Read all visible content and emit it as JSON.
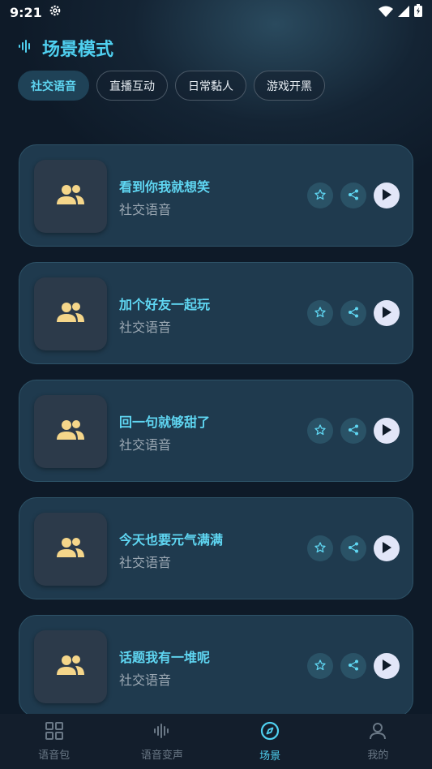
{
  "status_bar": {
    "time": "9:21"
  },
  "header": {
    "title": "场景模式",
    "icon": "sound-wave-icon"
  },
  "tabs": [
    {
      "label": "社交语音",
      "active": true
    },
    {
      "label": "直播互动",
      "active": false
    },
    {
      "label": "日常黏人",
      "active": false
    },
    {
      "label": "游戏开黑",
      "active": false
    }
  ],
  "cards": [
    {
      "title": "看到你我就想笑",
      "subtitle": "社交语音",
      "icon": "people-icon"
    },
    {
      "title": "加个好友一起玩",
      "subtitle": "社交语音",
      "icon": "people-icon"
    },
    {
      "title": "回一句就够甜了",
      "subtitle": "社交语音",
      "icon": "people-icon"
    },
    {
      "title": "今天也要元气满满",
      "subtitle": "社交语音",
      "icon": "people-icon"
    },
    {
      "title": "话题我有一堆呢",
      "subtitle": "社交语音",
      "icon": "people-icon"
    }
  ],
  "bottom_nav": [
    {
      "label": "语音包",
      "icon": "grid-icon",
      "active": false
    },
    {
      "label": "语音变声",
      "icon": "sound-wave-icon",
      "active": false
    },
    {
      "label": "场景",
      "icon": "compass-icon",
      "active": true
    },
    {
      "label": "我的",
      "icon": "person-icon",
      "active": false
    }
  ],
  "colors": {
    "accent": "#4fd0f0",
    "card_bg": "#1f3a4e",
    "people_icon": "#f5d68a"
  }
}
